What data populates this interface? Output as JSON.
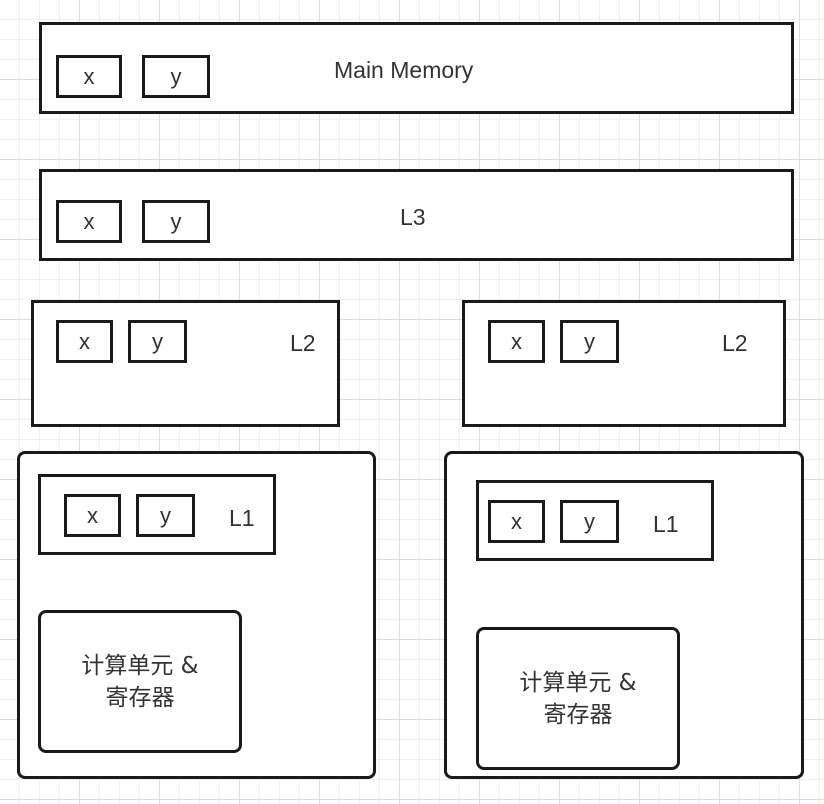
{
  "main_memory": {
    "label": "Main Memory",
    "cells": [
      "x",
      "y"
    ]
  },
  "l3": {
    "label": "L3",
    "cells": [
      "x",
      "y"
    ]
  },
  "cores": [
    {
      "l2": {
        "label": "L2",
        "cells": [
          "x",
          "y"
        ]
      },
      "l1": {
        "label": "L1",
        "cells": [
          "x",
          "y"
        ]
      },
      "unit": {
        "line1": "计算单元 &",
        "line2": "寄存器"
      }
    },
    {
      "l2": {
        "label": "L2",
        "cells": [
          "x",
          "y"
        ]
      },
      "l1": {
        "label": "L1",
        "cells": [
          "x",
          "y"
        ]
      },
      "unit": {
        "line1": "计算单元 &",
        "line2": "寄存器"
      }
    }
  ]
}
